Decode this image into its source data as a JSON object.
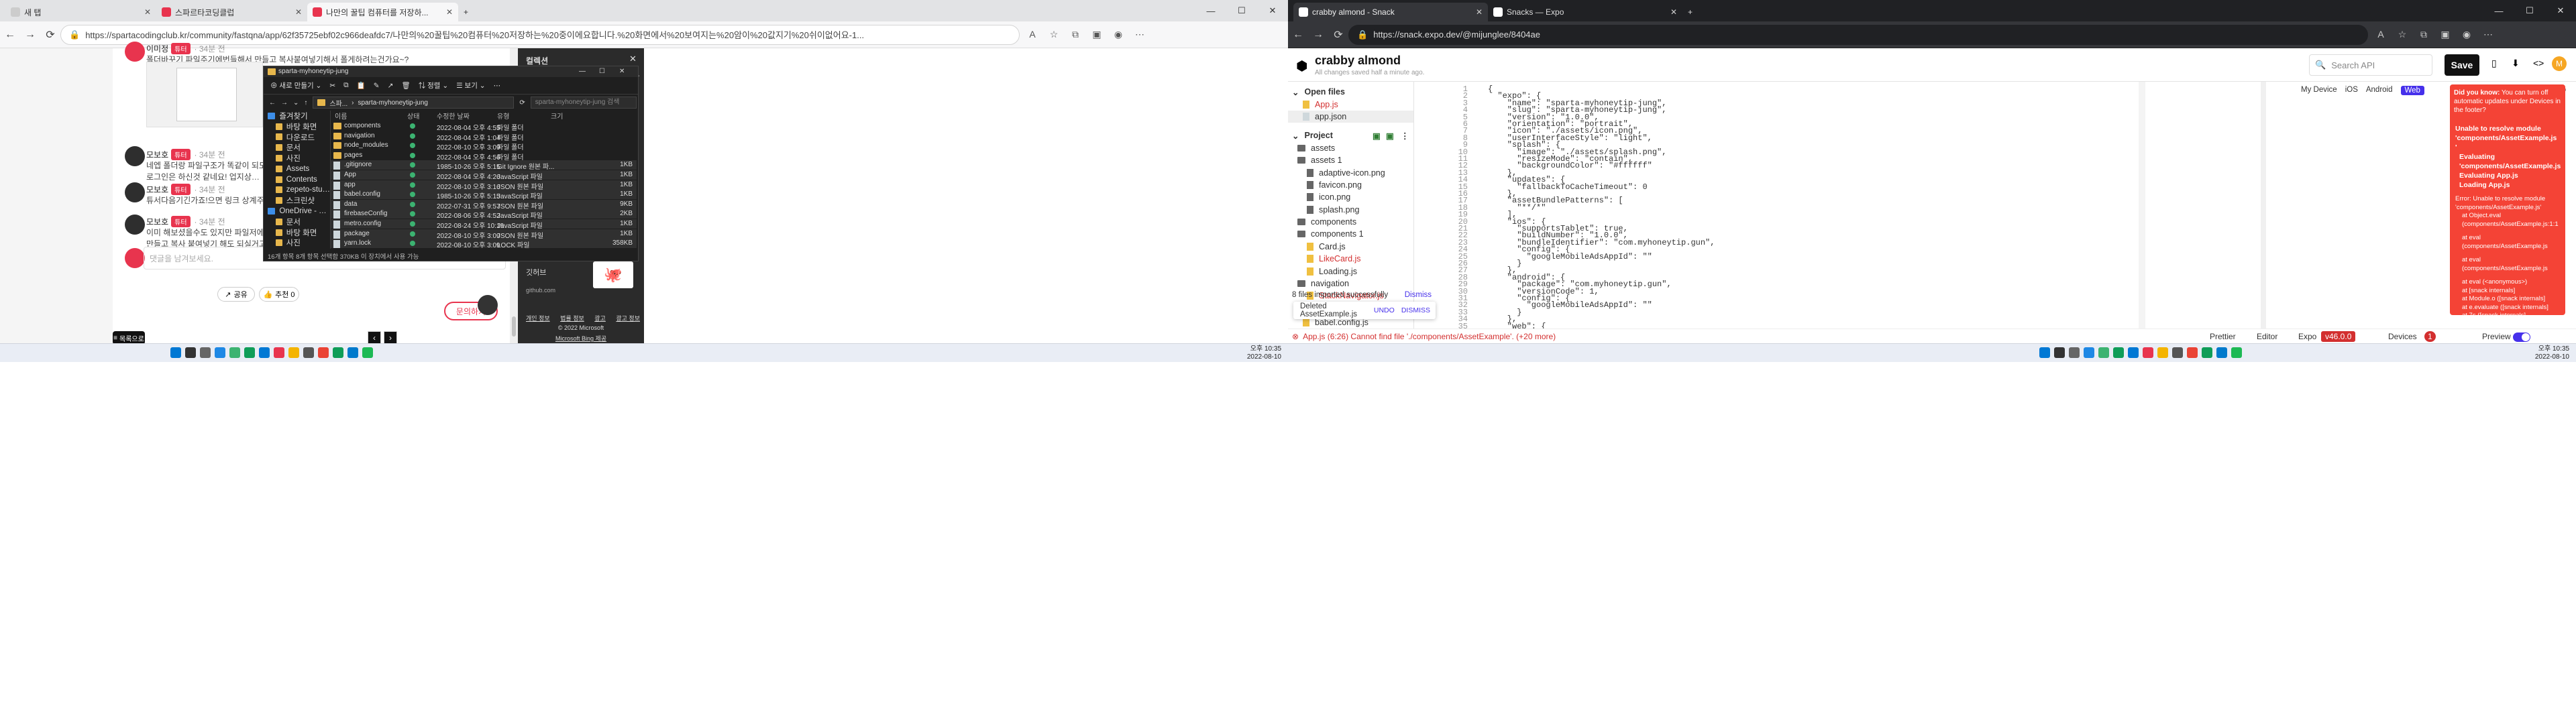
{
  "left": {
    "tabs": [
      {
        "label": "새 탭"
      },
      {
        "label": "스파르타코딩클럽"
      },
      {
        "label": "나만의 꿀팁 컴퓨터를 저장하..."
      }
    ],
    "url": "https://spartacodingclub.kr/community/fastqna/app/62f35725ebf02c966deafdc7/나만의%20꿀팁%20컴퓨터%20저장하는%20중이에요합니다.%20화면에서%20보여지는%20암이%20값지기%20쉬이없어요-1...",
    "posts": [
      {
        "author": "이미정",
        "badge": "튜터",
        "time": "· 34분 전",
        "text": "폴더바꾸기 파일주기에번들해서 만들고 복사붙여넣기해서 폴게하려는건가요~?"
      },
      {
        "author": "모보호",
        "badge": "튜터",
        "time": "· 34분 전",
        "text": "네엡 폴더랑 파일구조가 똑같이 되도록하시면 됩니다",
        "text2": "로그인은 하신것 같네요! 업지상금에 보여지는 부분들을 모두 넣으시면 됩니다"
      },
      {
        "author": "모보호",
        "badge": "튜터",
        "time": "· 34분 전",
        "text": "튜서다음기긴가죠!으면 링크 상계주시면 확인해보겠습니다"
      },
      {
        "author": "모보호",
        "badge": "튜터",
        "time": "· 34분 전",
        "text": "이미 해보셨을수도 있지만 파일저에도 혹정합에도 갑니다",
        "text2": "만들고 복사 붙여넣기 해도 되실거고 편하신 방법으로 옮기시면 됩니다."
      }
    ],
    "comment_placeholder": "댓글을 남겨보세요.",
    "share_label": "공유",
    "recommend_label": "추천 0",
    "inquiry_label": "문의하기",
    "toc_label": "목록으로",
    "explorer": {
      "title": "sparta-myhoneytip-jung",
      "new_label": "새로 만들기",
      "sort_label": "정렬",
      "view_label": "보기",
      "path_a": "스파...",
      "path_b": "sparta-myhoneytip-jung",
      "search_placeholder": "sparta-myhoneytip-jung 검색",
      "headers": {
        "name": "이름",
        "status": "상태",
        "date": "수정한 날짜",
        "type": "유형",
        "size": "크기"
      },
      "tree": [
        "즐겨찾기",
        "바탕 화면",
        "다운로드",
        "문서",
        "사진",
        "Assets",
        "Contents",
        "zepeto-studio-unity-3.1",
        "스크린샷",
        "OneDrive - Personal",
        "문서",
        "바탕 화면",
        "사진"
      ],
      "files": [
        {
          "name": "components",
          "date": "2022-08-04 오후 4:55",
          "type": "파일 폴더",
          "size": "",
          "kind": "folder"
        },
        {
          "name": "navigation",
          "date": "2022-08-04 오후 1:04",
          "type": "파일 폴더",
          "size": "",
          "kind": "folder"
        },
        {
          "name": "node_modules",
          "date": "2022-08-10 오후 3:09",
          "type": "파일 폴더",
          "size": "",
          "kind": "folder"
        },
        {
          "name": "pages",
          "date": "2022-08-04 오후 4:56",
          "type": "파일 폴더",
          "size": "",
          "kind": "folder"
        },
        {
          "name": ".gitignore",
          "date": "1985-10-26 오후 5:15",
          "type": "Git Ignore 원본 파...",
          "size": "1KB",
          "kind": "file"
        },
        {
          "name": "App",
          "date": "2022-08-04 오후 4:26",
          "type": "JavaScript 파일",
          "size": "1KB",
          "kind": "file"
        },
        {
          "name": "app",
          "date": "2022-08-10 오후 3:16",
          "type": "JSON 원본 파일",
          "size": "1KB",
          "kind": "file"
        },
        {
          "name": "babel.config",
          "date": "1985-10-26 오후 5:15",
          "type": "JavaScript 파일",
          "size": "1KB",
          "kind": "file"
        },
        {
          "name": "data",
          "date": "2022-07-31 오후 9:57",
          "type": "JSON 원본 파일",
          "size": "9KB",
          "kind": "file"
        },
        {
          "name": "firebaseConfig",
          "date": "2022-08-06 오후 4:52",
          "type": "JavaScript 파일",
          "size": "2KB",
          "kind": "file"
        },
        {
          "name": "metro.config",
          "date": "2022-08-24 오후 10:19",
          "type": "JavaScript 파일",
          "size": "1KB",
          "kind": "file"
        },
        {
          "name": "package",
          "date": "2022-08-10 오후 3:09",
          "type": "JSON 원본 파일",
          "size": "1KB",
          "kind": "file"
        },
        {
          "name": "yarn.lock",
          "date": "2022-08-10 오후 3:09",
          "type": "LOCK 파일",
          "size": "358KB",
          "kind": "file"
        }
      ],
      "status": "16개 항목   8개 항목 선택함 370KB   이 장치에서 사용 가능"
    },
    "panel": {
      "title": "컬렉션",
      "sub": "코딩",
      "github_label": "깃허브",
      "github_url": "github.com",
      "links": [
        "개인 정보",
        "법률 정보",
        "광고",
        "광고 정보"
      ],
      "copyright": "© 2022 Microsoft",
      "bing": "Microsoft Bing 제공"
    },
    "clock": {
      "time": "오후 10:35",
      "date": "2022-08-10"
    }
  },
  "right": {
    "tabs": [
      {
        "label": "crabby almond - Snack"
      },
      {
        "label": "Snacks — Expo"
      }
    ],
    "url": "https://snack.expo.dev/@mijunglee/8404ae",
    "project_name": "crabby almond",
    "saved": "All changes saved half a minute ago.",
    "search_placeholder": "Search API",
    "save_label": "Save",
    "devices": [
      "My Device",
      "iOS",
      "Android",
      "Web"
    ],
    "open_files_label": "Open files",
    "open_files": [
      "App.js",
      "app.json"
    ],
    "project_label": "Project",
    "tree": [
      {
        "name": "assets",
        "kind": "folder",
        "level": 1
      },
      {
        "name": "assets 1",
        "kind": "folder",
        "level": 1
      },
      {
        "name": "adaptive-icon.png",
        "kind": "image",
        "level": 2
      },
      {
        "name": "favicon.png",
        "kind": "image",
        "level": 2
      },
      {
        "name": "icon.png",
        "kind": "image",
        "level": 2
      },
      {
        "name": "splash.png",
        "kind": "image",
        "level": 2
      },
      {
        "name": "components",
        "kind": "folder",
        "level": 1
      },
      {
        "name": "components 1",
        "kind": "folder",
        "level": 1
      },
      {
        "name": "Card.js",
        "kind": "js",
        "level": 2
      },
      {
        "name": "LikeCard.js",
        "kind": "jserr",
        "level": 2
      },
      {
        "name": "Loading.js",
        "kind": "js",
        "level": 2
      },
      {
        "name": "navigation",
        "kind": "folder",
        "level": 1
      },
      {
        "name": "StackNavigator.js",
        "kind": "jserr",
        "level": 2
      },
      {
        "name": "pages",
        "kind": "folder",
        "level": 1
      }
    ],
    "tree_bottom": "babel.config.js",
    "code_lines": [
      "{",
      "  \"expo\": {",
      "    \"name\": \"sparta-myhoneytip-jung\",",
      "    \"slug\": \"sparta-myhoneytip-jung\",",
      "    \"version\": \"1.0.0\",",
      "    \"orientation\": \"portrait\",",
      "    \"icon\": \"./assets/icon.png\",",
      "    \"userInterfaceStyle\": \"light\",",
      "    \"splash\": {",
      "      \"image\": \"./assets/splash.png\",",
      "      \"resizeMode\": \"contain\",",
      "      \"backgroundColor\": \"#ffffff\"",
      "    },",
      "    \"updates\": {",
      "      \"fallbackToCacheTimeout\": 0",
      "    },",
      "    \"assetBundlePatterns\": [",
      "      \"**/*\"",
      "    ],",
      "    \"ios\": {",
      "      \"supportsTablet\": true,",
      "      \"buildNumber\": \"1.0.0\",",
      "      \"bundleIdentifier\": \"com.myhoneytip.gun\",",
      "      \"config\": {",
      "        \"googleMobileAdsAppId\": \"\"",
      "      }",
      "    },",
      "    \"android\": {",
      "      \"package\": \"com.myhoneytip.gun\",",
      "      \"versionCode\": 1,",
      "      \"config\": {",
      "        \"googleMobileAdsAppId\": \"\"",
      "      }",
      "    },",
      "    \"web\": {"
    ],
    "toast1": "8 files imported successfully",
    "toast1_action": "Dismiss",
    "toast2": "Deleted AssetExample.js",
    "toast2_undo": "UNDO",
    "toast2_dismiss": "DISMISS",
    "didyouknow_title": "Did you know:",
    "didyouknow_text": "You can turn off automatic updates under Devices in the footer?",
    "error_lines": [
      "Unable to resolve module 'components/AssetExample.js",
      "'",
      "Evaluating 'components/AssetExample.js",
      "Evaluating App.js",
      "Loading App.js"
    ],
    "error_detail": [
      "Error: Unable to resolve module 'components/AssetExample.js'",
      "at Object.eval (components/AssetExample.js:1:1",
      "",
      "at eval (components/AssetExample.js",
      "",
      "at eval (components/AssetExample.js",
      "",
      "at eval (<anonymous>)",
      "at [snack internals]",
      "at Module.o ([snack internals]",
      "at e.evaluate ([snack internals]",
      "at 7s ([snack internals]"
    ],
    "status_error": "App.js (6:26) Cannot find file './components/AssetExample'. (+20 more)",
    "status_items": {
      "prettier": "Prettier",
      "editor": "Editor",
      "expo": "Expo",
      "version": "v46.0.0",
      "devices": "Devices",
      "devices_count": "1",
      "preview": "Preview"
    },
    "clock": {
      "time": "오후 10:35",
      "date": "2022-08-10"
    },
    "accent": "#4630eb",
    "error_color": "#f44336"
  }
}
